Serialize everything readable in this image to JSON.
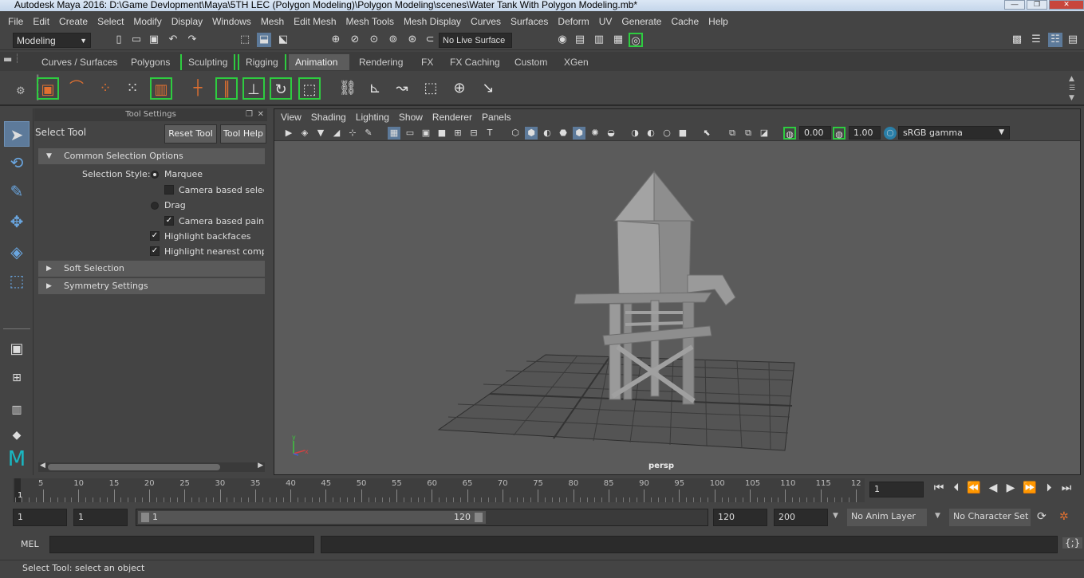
{
  "window": {
    "title": "Autodesk Maya 2016: D:\\Game Devlopment\\Maya\\5TH LEC (Polygon Modeling)\\Polygon Modeling\\scenes\\Water Tank With Polygon Modeling.mb*",
    "min": "—",
    "max": "❐",
    "close": "✕"
  },
  "menu": [
    "File",
    "Edit",
    "Create",
    "Select",
    "Modify",
    "Display",
    "Windows",
    "Mesh",
    "Edit Mesh",
    "Mesh Tools",
    "Mesh Display",
    "Curves",
    "Surfaces",
    "Deform",
    "UV",
    "Generate",
    "Cache",
    "Help"
  ],
  "statusline": {
    "mode": "Modeling",
    "live_surface": "No Live Surface"
  },
  "shelf_tabs": [
    "Curves / Surfaces",
    "Polygons",
    "Sculpting",
    "Rigging",
    "Animation",
    "Rendering",
    "FX",
    "FX Caching",
    "Custom",
    "XGen"
  ],
  "active_shelf_tab": "Animation",
  "tool_settings": {
    "panel_title": "Tool Settings",
    "tool_name": "Select Tool",
    "reset_button": "Reset Tool",
    "help_button": "Tool Help",
    "sections": {
      "common": "Common Selection Options",
      "soft": "Soft Selection",
      "symmetry": "Symmetry Settings"
    },
    "selection_style_label": "Selection Style:",
    "marquee": "Marquee",
    "camera_based_selection": "Camera based selecti",
    "drag": "Drag",
    "camera_based_paint": "Camera based paint s",
    "highlight_backfaces": "Highlight backfaces",
    "highlight_nearest": "Highlight nearest compo"
  },
  "viewport": {
    "menu": [
      "View",
      "Shading",
      "Lighting",
      "Show",
      "Renderer",
      "Panels"
    ],
    "camera": "persp",
    "exposure": "0.00",
    "gamma": "1.00",
    "color_space": "sRGB gamma",
    "axis_x": "x",
    "axis_y": "y"
  },
  "timeline": {
    "ticks": [
      "5",
      "10",
      "15",
      "20",
      "25",
      "30",
      "35",
      "40",
      "45",
      "50",
      "55",
      "60",
      "65",
      "70",
      "75",
      "80",
      "85",
      "90",
      "95",
      "100",
      "105",
      "110",
      "115",
      "12"
    ],
    "current_frame_marker": "1",
    "current_frame": "1"
  },
  "range": {
    "start": "1",
    "anim_start": "1",
    "slider_start": "1",
    "slider_end": "120",
    "end": "120",
    "anim_end": "200",
    "anim_layer": "No Anim Layer",
    "character_set": "No Character Set"
  },
  "command_line": {
    "label": "MEL"
  },
  "help_line": "Select Tool: select an object"
}
